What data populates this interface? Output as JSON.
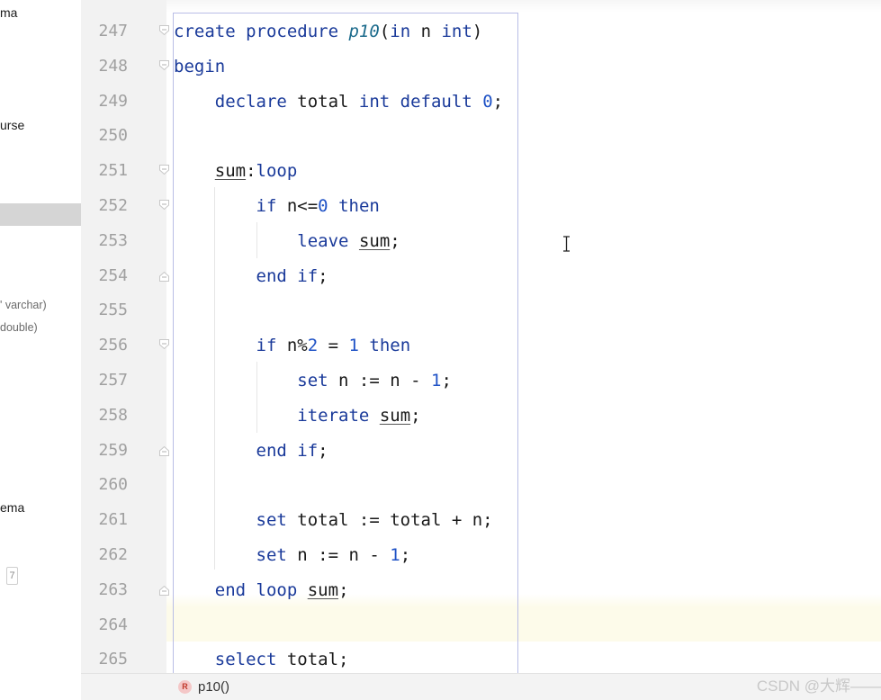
{
  "sidebar": {
    "items": [
      {
        "text": "ma"
      },
      {
        "text": "urse"
      },
      {
        "text": "' varchar)"
      },
      {
        "text": "double)"
      },
      {
        "text": "ema"
      }
    ],
    "badge": "7"
  },
  "editor": {
    "line_numbers": [
      "247",
      "248",
      "249",
      "250",
      "251",
      "252",
      "253",
      "254",
      "255",
      "256",
      "257",
      "258",
      "259",
      "260",
      "261",
      "262",
      "263",
      "264",
      "265"
    ],
    "lines": [
      {
        "n": "247",
        "tokens": [
          {
            "t": "create procedure ",
            "c": "kw"
          },
          {
            "t": "p10",
            "c": "fn"
          },
          {
            "t": "(",
            "c": ""
          },
          {
            "t": "in",
            "c": "kw"
          },
          {
            "t": " n ",
            "c": ""
          },
          {
            "t": "int",
            "c": "kw"
          },
          {
            "t": ")",
            "c": ""
          }
        ]
      },
      {
        "n": "248",
        "tokens": [
          {
            "t": "begin",
            "c": "kw"
          }
        ]
      },
      {
        "n": "249",
        "tokens": [
          {
            "t": "    ",
            "c": ""
          },
          {
            "t": "declare",
            "c": "kw"
          },
          {
            "t": " total ",
            "c": ""
          },
          {
            "t": "int default",
            "c": "kw"
          },
          {
            "t": " ",
            "c": ""
          },
          {
            "t": "0",
            "c": "num"
          },
          {
            "t": ";",
            "c": ""
          }
        ]
      },
      {
        "n": "250",
        "tokens": []
      },
      {
        "n": "251",
        "tokens": [
          {
            "t": "    ",
            "c": ""
          },
          {
            "t": "sum",
            "c": "lbl"
          },
          {
            "t": ":",
            "c": ""
          },
          {
            "t": "loop",
            "c": "kw"
          }
        ]
      },
      {
        "n": "252",
        "tokens": [
          {
            "t": "        ",
            "c": ""
          },
          {
            "t": "if",
            "c": "kw"
          },
          {
            "t": " n<=",
            "c": ""
          },
          {
            "t": "0",
            "c": "num"
          },
          {
            "t": " ",
            "c": ""
          },
          {
            "t": "then",
            "c": "kw"
          }
        ]
      },
      {
        "n": "253",
        "tokens": [
          {
            "t": "            ",
            "c": ""
          },
          {
            "t": "leave",
            "c": "kw"
          },
          {
            "t": " ",
            "c": ""
          },
          {
            "t": "sum",
            "c": "lbl"
          },
          {
            "t": ";",
            "c": ""
          }
        ]
      },
      {
        "n": "254",
        "tokens": [
          {
            "t": "        ",
            "c": ""
          },
          {
            "t": "end if",
            "c": "kw"
          },
          {
            "t": ";",
            "c": ""
          }
        ]
      },
      {
        "n": "255",
        "tokens": []
      },
      {
        "n": "256",
        "tokens": [
          {
            "t": "        ",
            "c": ""
          },
          {
            "t": "if",
            "c": "kw"
          },
          {
            "t": " n%",
            "c": ""
          },
          {
            "t": "2",
            "c": "num"
          },
          {
            "t": " = ",
            "c": ""
          },
          {
            "t": "1",
            "c": "num"
          },
          {
            "t": " ",
            "c": ""
          },
          {
            "t": "then",
            "c": "kw"
          }
        ]
      },
      {
        "n": "257",
        "tokens": [
          {
            "t": "            ",
            "c": ""
          },
          {
            "t": "set",
            "c": "kw"
          },
          {
            "t": " n := n - ",
            "c": ""
          },
          {
            "t": "1",
            "c": "num"
          },
          {
            "t": ";",
            "c": ""
          }
        ]
      },
      {
        "n": "258",
        "tokens": [
          {
            "t": "            ",
            "c": ""
          },
          {
            "t": "iterate",
            "c": "kw"
          },
          {
            "t": " ",
            "c": ""
          },
          {
            "t": "sum",
            "c": "lbl"
          },
          {
            "t": ";",
            "c": ""
          }
        ]
      },
      {
        "n": "259",
        "tokens": [
          {
            "t": "        ",
            "c": ""
          },
          {
            "t": "end if",
            "c": "kw"
          },
          {
            "t": ";",
            "c": ""
          }
        ]
      },
      {
        "n": "260",
        "tokens": []
      },
      {
        "n": "261",
        "tokens": [
          {
            "t": "        ",
            "c": ""
          },
          {
            "t": "set",
            "c": "kw"
          },
          {
            "t": " total := total + n;",
            "c": ""
          }
        ]
      },
      {
        "n": "262",
        "tokens": [
          {
            "t": "        ",
            "c": ""
          },
          {
            "t": "set",
            "c": "kw"
          },
          {
            "t": " n := n - ",
            "c": ""
          },
          {
            "t": "1",
            "c": "num"
          },
          {
            "t": ";",
            "c": ""
          }
        ]
      },
      {
        "n": "263",
        "tokens": [
          {
            "t": "    ",
            "c": ""
          },
          {
            "t": "end loop",
            "c": "kw"
          },
          {
            "t": " ",
            "c": ""
          },
          {
            "t": "sum",
            "c": "lbl"
          },
          {
            "t": ";",
            "c": ""
          }
        ]
      },
      {
        "n": "264",
        "tokens": []
      },
      {
        "n": "265",
        "tokens": [
          {
            "t": "    ",
            "c": ""
          },
          {
            "t": "select",
            "c": "kw"
          },
          {
            "t": " total;",
            "c": ""
          }
        ]
      }
    ],
    "fold_markers": [
      {
        "line": "247",
        "kind": "open"
      },
      {
        "line": "248",
        "kind": "open"
      },
      {
        "line": "251",
        "kind": "open"
      },
      {
        "line": "252",
        "kind": "open"
      },
      {
        "line": "254",
        "kind": "close"
      },
      {
        "line": "256",
        "kind": "open"
      },
      {
        "line": "259",
        "kind": "close"
      },
      {
        "line": "263",
        "kind": "close"
      }
    ],
    "current_line": "264"
  },
  "status_bar": {
    "icon_letter": "R",
    "routine": "p10()"
  },
  "watermark": "CSDN @大辉——",
  "colors": {
    "keyword": "#1a3a9a",
    "number": "#1f52c6",
    "function": "#1c6b8c",
    "current_line_bg": "#fdfbea",
    "gutter_bg": "#f2f2f2"
  }
}
